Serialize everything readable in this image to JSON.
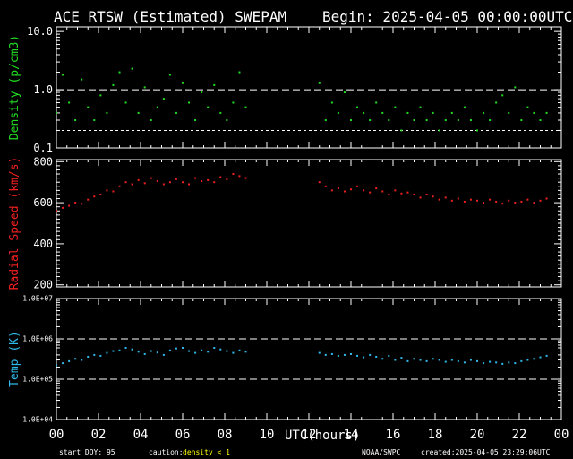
{
  "header": {
    "title": "ACE RTSW (Estimated) SWEPAM",
    "begin": "Begin: 2025-04-05 00:00:00UTC"
  },
  "footer": {
    "start_doy": "start DOY:  95",
    "caution_label": "caution:",
    "caution_text": "density < 1",
    "agency": "NOAA/SWPC",
    "created": "created:2025-04-05 23:29:06UTC"
  },
  "colors": {
    "background": "#000000",
    "axes": "#ffffff",
    "density": "#22dd22",
    "speed": "#ee2020",
    "temp": "#30b8e8",
    "caution": "#ffff00"
  },
  "chart_data": [
    {
      "type": "scatter",
      "ylabel": "Density (p/cm3)",
      "yscale": "log",
      "ylim": [
        0.1,
        12
      ],
      "yticks": [
        "10.0",
        "1.0",
        "0.1"
      ],
      "reference_lines": [
        1.0,
        0.2
      ],
      "xlim": [
        0,
        24
      ],
      "xticks": [
        "00",
        "02",
        "04",
        "06",
        "08",
        "10",
        "12",
        "14",
        "16",
        "18",
        "20",
        "22",
        "00"
      ],
      "data_gaps": [
        [
          9.2,
          12.4
        ]
      ],
      "series": [
        {
          "color": "#22dd22",
          "x": [
            0.0,
            0.3,
            0.6,
            0.9,
            1.2,
            1.5,
            1.8,
            2.1,
            2.4,
            2.7,
            3.0,
            3.3,
            3.6,
            3.9,
            4.2,
            4.5,
            4.8,
            5.1,
            5.4,
            5.7,
            6.0,
            6.3,
            6.6,
            6.9,
            7.2,
            7.5,
            7.8,
            8.1,
            8.4,
            8.7,
            9.0,
            12.5,
            12.8,
            13.1,
            13.4,
            13.7,
            14.0,
            14.3,
            14.6,
            14.9,
            15.2,
            15.5,
            15.8,
            16.1,
            16.4,
            16.7,
            17.0,
            17.3,
            17.6,
            17.9,
            18.2,
            18.5,
            18.8,
            19.1,
            19.4,
            19.7,
            20.0,
            20.3,
            20.6,
            20.9,
            21.2,
            21.5,
            21.8,
            22.1,
            22.4,
            22.7,
            23.0,
            23.3
          ],
          "y": [
            0.4,
            1.8,
            0.6,
            0.3,
            1.5,
            0.5,
            0.3,
            0.8,
            0.4,
            1.2,
            2.0,
            0.6,
            2.3,
            0.4,
            1.1,
            0.3,
            0.5,
            0.7,
            1.8,
            0.4,
            1.3,
            0.6,
            0.3,
            0.9,
            0.5,
            1.2,
            0.4,
            0.3,
            0.6,
            2.0,
            0.5,
            1.3,
            0.3,
            0.6,
            0.4,
            0.9,
            0.3,
            0.5,
            0.4,
            0.3,
            0.6,
            0.4,
            0.3,
            0.5,
            0.2,
            0.4,
            0.3,
            0.5,
            0.3,
            0.4,
            0.2,
            0.3,
            0.4,
            0.3,
            0.5,
            0.3,
            0.2,
            0.4,
            0.3,
            0.6,
            0.8,
            0.4,
            1.1,
            0.3,
            0.5,
            0.4,
            0.3,
            0.4
          ]
        }
      ]
    },
    {
      "type": "scatter",
      "ylabel": "Radial Speed (km/s)",
      "ylim": [
        190,
        810
      ],
      "yticks": [
        "800",
        "600",
        "400",
        "200"
      ],
      "xlim": [
        0,
        24
      ],
      "data_gaps": [
        [
          9.2,
          12.4
        ]
      ],
      "series": [
        {
          "color": "#ee2020",
          "x": [
            0.0,
            0.3,
            0.6,
            0.9,
            1.2,
            1.5,
            1.8,
            2.1,
            2.4,
            2.7,
            3.0,
            3.3,
            3.6,
            3.9,
            4.2,
            4.5,
            4.8,
            5.1,
            5.4,
            5.7,
            6.0,
            6.3,
            6.6,
            6.9,
            7.2,
            7.5,
            7.8,
            8.1,
            8.4,
            8.7,
            9.0,
            12.5,
            12.8,
            13.1,
            13.4,
            13.7,
            14.0,
            14.3,
            14.6,
            14.9,
            15.2,
            15.5,
            15.8,
            16.1,
            16.4,
            16.7,
            17.0,
            17.3,
            17.6,
            17.9,
            18.2,
            18.5,
            18.8,
            19.1,
            19.4,
            19.7,
            20.0,
            20.3,
            20.6,
            20.9,
            21.2,
            21.5,
            21.8,
            22.1,
            22.4,
            22.7,
            23.0,
            23.3
          ],
          "y": [
            560,
            575,
            585,
            600,
            595,
            615,
            630,
            640,
            660,
            655,
            680,
            700,
            690,
            710,
            695,
            720,
            705,
            690,
            700,
            715,
            700,
            690,
            720,
            705,
            710,
            700,
            725,
            715,
            740,
            730,
            720,
            700,
            680,
            660,
            670,
            655,
            665,
            680,
            660,
            650,
            670,
            655,
            640,
            660,
            645,
            650,
            640,
            625,
            640,
            630,
            615,
            625,
            610,
            620,
            605,
            615,
            610,
            600,
            615,
            605,
            595,
            610,
            600,
            605,
            615,
            600,
            610,
            620
          ]
        }
      ]
    },
    {
      "type": "scatter",
      "ylabel": "Temp (K)",
      "yscale": "log",
      "ylim": [
        10000,
        10000000
      ],
      "yticks": [
        "1.0E+07",
        "1.0E+06",
        "1.0E+05",
        "1.0E+04"
      ],
      "reference_lines": [
        1000000,
        100000
      ],
      "xlim": [
        0,
        24
      ],
      "data_gaps": [
        [
          9.2,
          12.4
        ]
      ],
      "series": [
        {
          "color": "#30b8e8",
          "x": [
            0.0,
            0.3,
            0.6,
            0.9,
            1.2,
            1.5,
            1.8,
            2.1,
            2.4,
            2.7,
            3.0,
            3.3,
            3.6,
            3.9,
            4.2,
            4.5,
            4.8,
            5.1,
            5.4,
            5.7,
            6.0,
            6.3,
            6.6,
            6.9,
            7.2,
            7.5,
            7.8,
            8.1,
            8.4,
            8.7,
            9.0,
            12.5,
            12.8,
            13.1,
            13.4,
            13.7,
            14.0,
            14.3,
            14.6,
            14.9,
            15.2,
            15.5,
            15.8,
            16.1,
            16.4,
            16.7,
            17.0,
            17.3,
            17.6,
            17.9,
            18.2,
            18.5,
            18.8,
            19.1,
            19.4,
            19.7,
            20.0,
            20.3,
            20.6,
            20.9,
            21.2,
            21.5,
            21.8,
            22.1,
            22.4,
            22.7,
            23.0,
            23.3
          ],
          "y": [
            220000,
            250000,
            280000,
            320000,
            300000,
            360000,
            400000,
            380000,
            450000,
            500000,
            520000,
            600000,
            550000,
            480000,
            420000,
            500000,
            460000,
            400000,
            520000,
            580000,
            600000,
            500000,
            450000,
            520000,
            480000,
            600000,
            550000,
            500000,
            450000,
            520000,
            480000,
            450000,
            400000,
            420000,
            380000,
            400000,
            420000,
            380000,
            350000,
            400000,
            360000,
            320000,
            380000,
            300000,
            340000,
            280000,
            320000,
            300000,
            280000,
            320000,
            300000,
            270000,
            300000,
            280000,
            260000,
            300000,
            280000,
            250000,
            270000,
            260000,
            240000,
            260000,
            250000,
            280000,
            300000,
            320000,
            350000,
            380000
          ]
        }
      ]
    }
  ],
  "xlabel": "UTC(hours)"
}
